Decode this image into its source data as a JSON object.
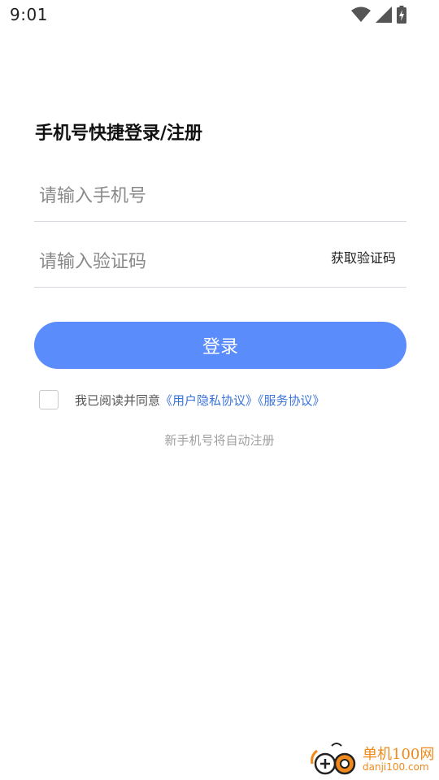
{
  "status_bar": {
    "time": "9:01",
    "icons": [
      "wifi-icon",
      "signal-icon",
      "battery-charging-icon"
    ]
  },
  "login": {
    "title": "手机号快捷登录/注册",
    "phone_placeholder": "请输入手机号",
    "code_placeholder": "请输入验证码",
    "get_code_label": "获取验证码",
    "login_button_label": "登录",
    "agree_prefix": "我已阅读并同意",
    "privacy_link": "《用户隐私协议》",
    "service_link": "《服务协议》",
    "agree_checked": false,
    "register_hint": "新手机号将自动注册"
  },
  "watermark": {
    "title": "单机100网",
    "url": "danji100.com"
  },
  "colors": {
    "accent": "#5b8cfb",
    "link": "#3b73d8",
    "watermark": "#f08a1c"
  }
}
